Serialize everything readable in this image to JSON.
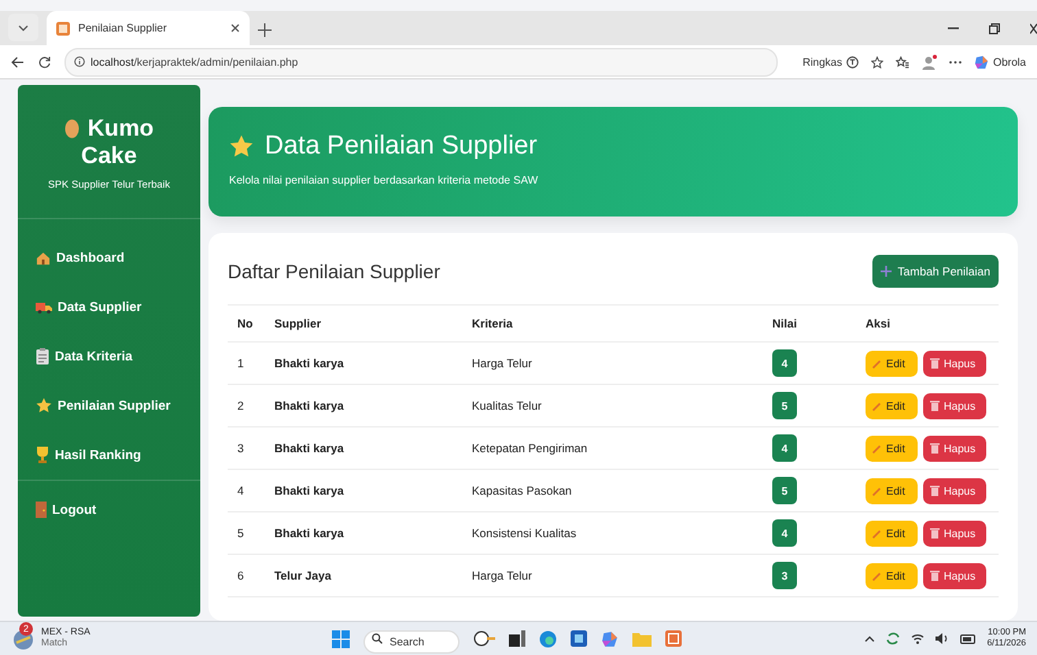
{
  "browser": {
    "tab_title": "Penilaian Supplier",
    "url_host": "localhost",
    "url_path": "/kerjapraktek/admin/penilaian.php",
    "summary_label": "Ringkas",
    "copilot_label": "Obrola"
  },
  "sidebar": {
    "brand": "Kumo Cake",
    "tagline": "SPK Supplier Telur Terbaik",
    "items": [
      {
        "label": "Dashboard",
        "kind": "house"
      },
      {
        "label": "Data Supplier",
        "kind": "truck"
      },
      {
        "label": "Data Kriteria",
        "kind": "clipboard"
      },
      {
        "label": "Penilaian Supplier",
        "kind": "star"
      },
      {
        "label": "Hasil Ranking",
        "kind": "trophy"
      }
    ],
    "logout": "Logout"
  },
  "header": {
    "title": "Data Penilaian Supplier",
    "subtitle": "Kelola nilai penilaian supplier berdasarkan kriteria metode SAW"
  },
  "table_card": {
    "title": "Daftar Penilaian Supplier",
    "add_button": "Tambah Penilaian",
    "columns": [
      "No",
      "Supplier",
      "Kriteria",
      "Nilai",
      "Aksi"
    ],
    "rows": [
      {
        "no": "1",
        "supplier": "Bhakti karya",
        "kriteria": "Harga Telur",
        "nilai": "4",
        "edit": "Edit",
        "delete": "Hapus"
      },
      {
        "no": "2",
        "supplier": "Bhakti karya",
        "kriteria": "Kualitas Telur",
        "nilai": "5",
        "edit": "Edit",
        "delete": "Hapus"
      },
      {
        "no": "3",
        "supplier": "Bhakti karya",
        "kriteria": "Ketepatan Pengiriman",
        "nilai": "4",
        "edit": "Edit",
        "delete": "Hapus"
      },
      {
        "no": "4",
        "supplier": "Bhakti karya",
        "kriteria": "Kapasitas Pasokan",
        "nilai": "5",
        "edit": "Edit",
        "delete": "Hapus"
      },
      {
        "no": "5",
        "supplier": "Bhakti karya",
        "kriteria": "Konsistensi Kualitas",
        "nilai": "4",
        "edit": "Edit",
        "delete": "Hapus"
      },
      {
        "no": "6",
        "supplier": "Telur Jaya",
        "kriteria": "Harga Telur",
        "nilai": "3",
        "edit": "Edit",
        "delete": "Hapus"
      }
    ]
  },
  "taskbar": {
    "widget_title": "MEX - RSA",
    "widget_subtitle": "Match",
    "widget_badge": "2",
    "search_placeholder": "Search",
    "time": "10:00 PM",
    "date": "6/11/2026"
  }
}
